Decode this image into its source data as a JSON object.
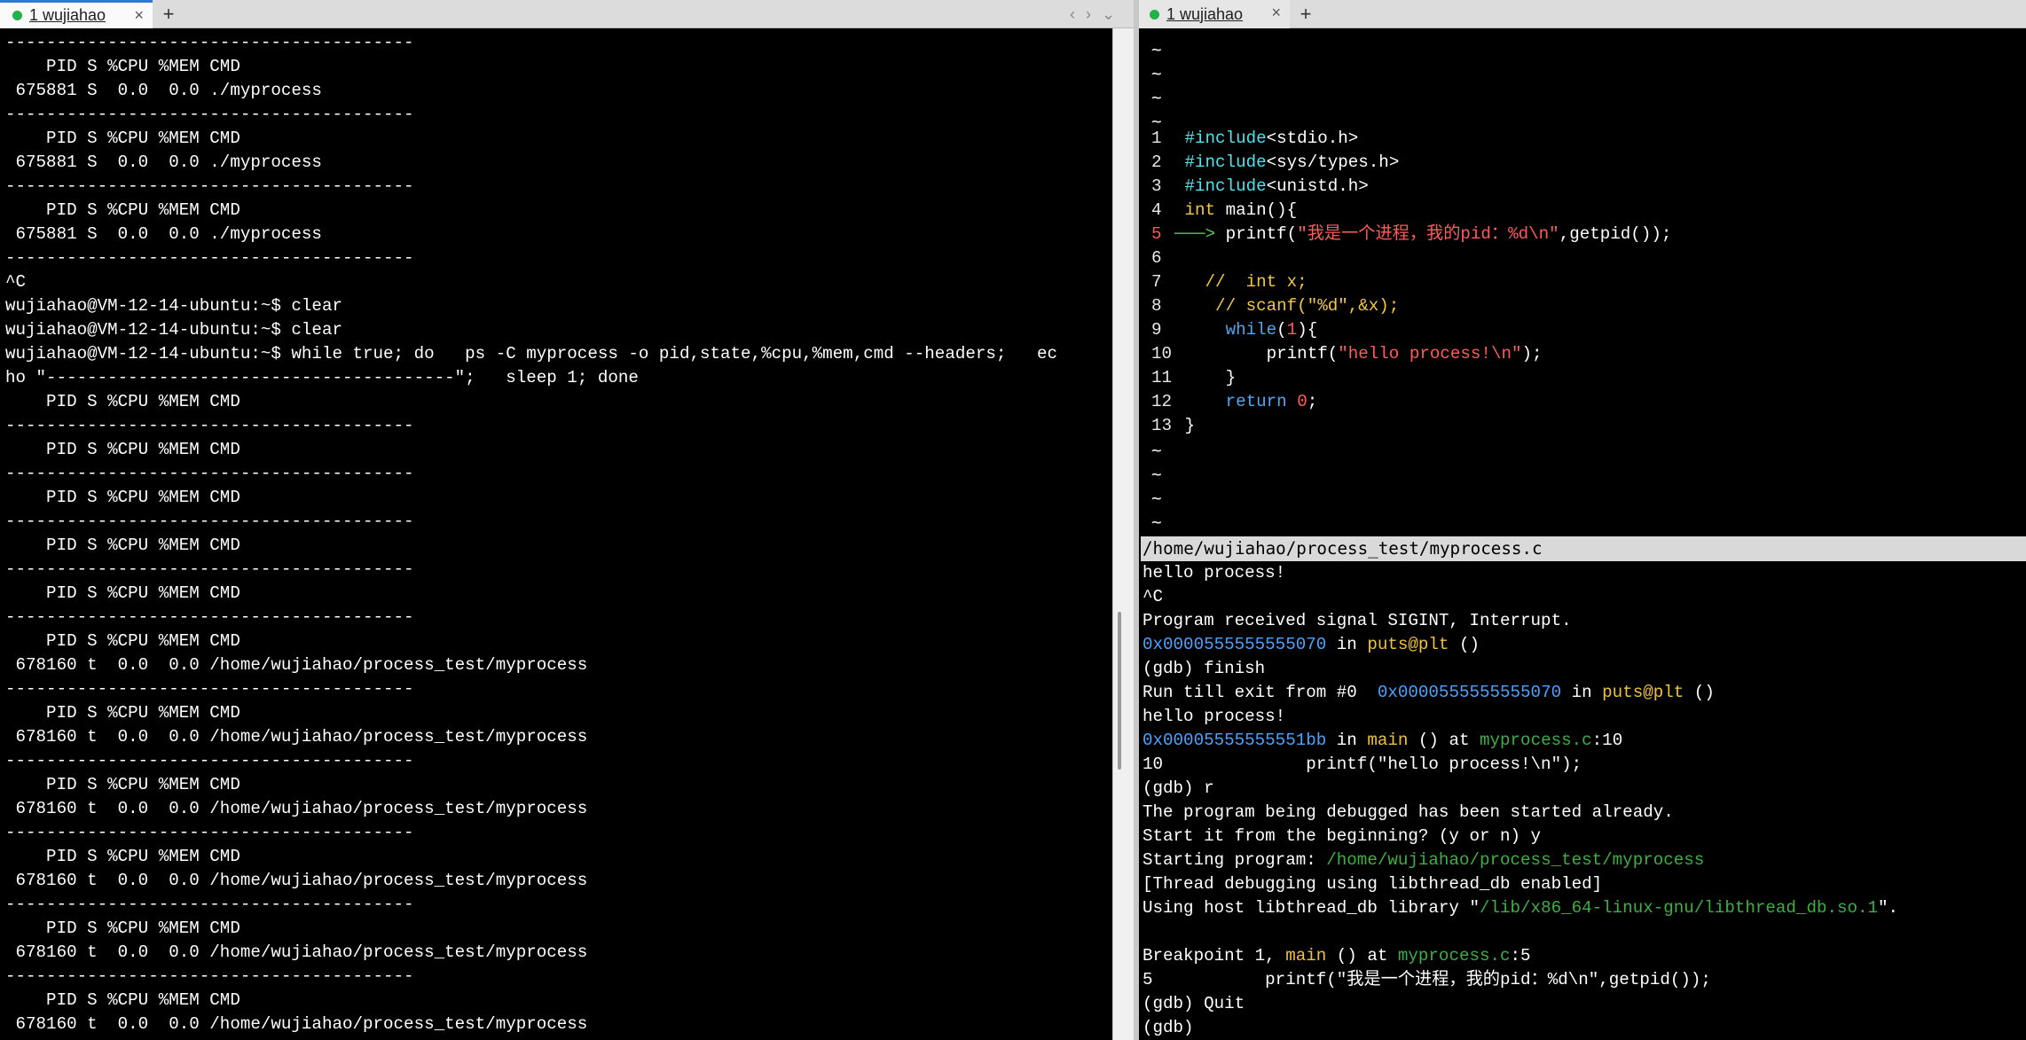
{
  "left_tab": {
    "label": "1 wujiahao",
    "close": "×"
  },
  "right_tab": {
    "label": "1 wujiahao",
    "close": "×"
  },
  "new_tab": "+",
  "nav": {
    "prev": "‹",
    "next": "›",
    "menu": "⌄"
  },
  "left_terminal": {
    "lines": [
      "----------------------------------------",
      "    PID S %CPU %MEM CMD",
      " 675881 S  0.0  0.0 ./myprocess",
      "----------------------------------------",
      "    PID S %CPU %MEM CMD",
      " 675881 S  0.0  0.0 ./myprocess",
      "----------------------------------------",
      "    PID S %CPU %MEM CMD",
      " 675881 S  0.0  0.0 ./myprocess",
      "----------------------------------------",
      "^C",
      "wujiahao@VM-12-14-ubuntu:~$ clear",
      "wujiahao@VM-12-14-ubuntu:~$ clear",
      "wujiahao@VM-12-14-ubuntu:~$ while true; do   ps -C myprocess -o pid,state,%cpu,%mem,cmd --headers;   ec",
      "ho \"----------------------------------------\";   sleep 1; done",
      "    PID S %CPU %MEM CMD",
      "----------------------------------------",
      "    PID S %CPU %MEM CMD",
      "----------------------------------------",
      "    PID S %CPU %MEM CMD",
      "----------------------------------------",
      "    PID S %CPU %MEM CMD",
      "----------------------------------------",
      "    PID S %CPU %MEM CMD",
      "----------------------------------------",
      "    PID S %CPU %MEM CMD",
      " 678160 t  0.0  0.0 /home/wujiahao/process_test/myprocess",
      "----------------------------------------",
      "    PID S %CPU %MEM CMD",
      " 678160 t  0.0  0.0 /home/wujiahao/process_test/myprocess",
      "----------------------------------------",
      "    PID S %CPU %MEM CMD",
      " 678160 t  0.0  0.0 /home/wujiahao/process_test/myprocess",
      "----------------------------------------",
      "    PID S %CPU %MEM CMD",
      " 678160 t  0.0  0.0 /home/wujiahao/process_test/myprocess",
      "----------------------------------------",
      "    PID S %CPU %MEM CMD",
      " 678160 t  0.0  0.0 /home/wujiahao/process_test/myprocess",
      "----------------------------------------",
      "    PID S %CPU %MEM CMD",
      " 678160 t  0.0  0.0 /home/wujiahao/process_test/myprocess"
    ]
  },
  "vim": {
    "tilde": "~",
    "filepath": "/home/wujiahao/process_test/myprocess.c",
    "current_line_arrow": "───>",
    "lines": [
      {
        "n": "1",
        "code": [
          [
            "pp",
            "#include"
          ],
          [
            "",
            "<stdio.h>"
          ]
        ]
      },
      {
        "n": "2",
        "code": [
          [
            "pp",
            "#include"
          ],
          [
            "",
            "<sys/types.h>"
          ]
        ]
      },
      {
        "n": "3",
        "code": [
          [
            "pp",
            "#include"
          ],
          [
            "",
            "<unistd.h>"
          ]
        ]
      },
      {
        "n": "4",
        "code": [
          [
            "ty",
            "int"
          ],
          [
            "",
            " main(){"
          ]
        ]
      },
      {
        "n": "5",
        "current": true,
        "code": [
          [
            "",
            " printf("
          ],
          [
            "str",
            "\"我是一个进程，我的pid：%d\\n\""
          ],
          [
            "",
            ",getpid());"
          ]
        ]
      },
      {
        "n": "6",
        "code": []
      },
      {
        "n": "7",
        "code": [
          [
            "cm",
            "  //  int x;"
          ]
        ]
      },
      {
        "n": "8",
        "code": [
          [
            "cm",
            "   // scanf(\"%d\",&x);"
          ]
        ]
      },
      {
        "n": "9",
        "code": [
          [
            "",
            "    "
          ],
          [
            "kw",
            "while"
          ],
          [
            "",
            "("
          ],
          [
            "num",
            "1"
          ],
          [
            "",
            "){"
          ]
        ]
      },
      {
        "n": "10",
        "code": [
          [
            "",
            "        printf("
          ],
          [
            "str",
            "\"hello process!\\n\""
          ],
          [
            "",
            ");"
          ]
        ]
      },
      {
        "n": "11",
        "code": [
          [
            "",
            "    }"
          ]
        ]
      },
      {
        "n": "12",
        "code": [
          [
            "",
            "    "
          ],
          [
            "kw",
            "return"
          ],
          [
            "",
            " "
          ],
          [
            "num",
            "0"
          ],
          [
            "",
            ";"
          ]
        ]
      },
      {
        "n": "13",
        "code": [
          [
            "",
            "}"
          ]
        ]
      }
    ]
  },
  "gdb": {
    "lines": [
      [
        [
          "",
          "hello process!"
        ]
      ],
      [
        [
          "",
          "^C"
        ]
      ],
      [
        [
          "",
          "Program received signal SIGINT, Interrupt."
        ]
      ],
      [
        [
          "addr",
          "0x0000555555555070"
        ],
        [
          "",
          " in "
        ],
        [
          "fn",
          "puts@plt"
        ],
        [
          "",
          " ()"
        ]
      ],
      [
        [
          "",
          "(gdb) finish"
        ]
      ],
      [
        [
          "",
          "Run till exit from #0  "
        ],
        [
          "addr",
          "0x0000555555555070"
        ],
        [
          "",
          " in "
        ],
        [
          "fn",
          "puts@plt"
        ],
        [
          "",
          " ()"
        ]
      ],
      [
        [
          "",
          "hello process!"
        ]
      ],
      [
        [
          "addr",
          "0x00005555555551bb"
        ],
        [
          "",
          " in "
        ],
        [
          "fn",
          "main"
        ],
        [
          "",
          " () at "
        ],
        [
          "file",
          "myprocess.c"
        ],
        [
          "",
          ":10"
        ]
      ],
      [
        [
          "",
          "10              printf(\"hello process!\\n\");"
        ]
      ],
      [
        [
          "",
          "(gdb) r"
        ]
      ],
      [
        [
          "",
          "The program being debugged has been started already."
        ]
      ],
      [
        [
          "",
          "Start it from the beginning? (y or n) y"
        ]
      ],
      [
        [
          "",
          "Starting program: "
        ],
        [
          "path",
          "/home/wujiahao/process_test/myprocess"
        ]
      ],
      [
        [
          "",
          "[Thread debugging using libthread_db enabled]"
        ]
      ],
      [
        [
          "",
          "Using host libthread_db library \""
        ],
        [
          "path",
          "/lib/x86_64-linux-gnu/libthread_db.so.1"
        ],
        [
          "",
          "\"."
        ]
      ],
      [
        [
          "",
          ""
        ]
      ],
      [
        [
          "",
          "Breakpoint 1, "
        ],
        [
          "fn",
          "main"
        ],
        [
          "",
          " () at "
        ],
        [
          "file",
          "myprocess.c"
        ],
        [
          "",
          ":5"
        ]
      ],
      [
        [
          "",
          "5           printf(\"我是一个进程，我的pid：%d\\n\",getpid());"
        ]
      ],
      [
        [
          "",
          "(gdb) Quit"
        ]
      ],
      [
        [
          "",
          "(gdb) "
        ]
      ]
    ]
  },
  "colors": {
    "tab_accent": "#2f7ad6",
    "status_dot": "#21b24b",
    "address": "#4aa3ff",
    "function": "#f0c23a",
    "file": "#3cb043"
  }
}
